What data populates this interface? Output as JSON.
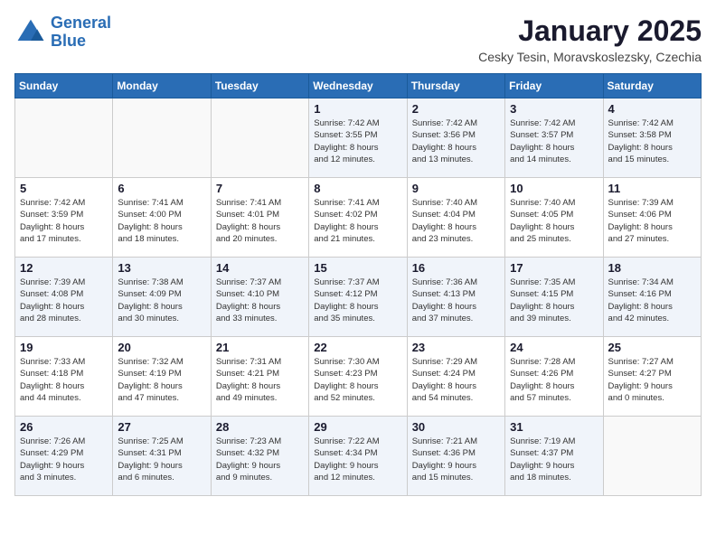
{
  "logo": {
    "line1": "General",
    "line2": "Blue"
  },
  "title": "January 2025",
  "location": "Cesky Tesin, Moravskoslezsky, Czechia",
  "days_of_week": [
    "Sunday",
    "Monday",
    "Tuesday",
    "Wednesday",
    "Thursday",
    "Friday",
    "Saturday"
  ],
  "weeks": [
    [
      {
        "day": "",
        "info": ""
      },
      {
        "day": "",
        "info": ""
      },
      {
        "day": "",
        "info": ""
      },
      {
        "day": "1",
        "info": "Sunrise: 7:42 AM\nSunset: 3:55 PM\nDaylight: 8 hours\nand 12 minutes."
      },
      {
        "day": "2",
        "info": "Sunrise: 7:42 AM\nSunset: 3:56 PM\nDaylight: 8 hours\nand 13 minutes."
      },
      {
        "day": "3",
        "info": "Sunrise: 7:42 AM\nSunset: 3:57 PM\nDaylight: 8 hours\nand 14 minutes."
      },
      {
        "day": "4",
        "info": "Sunrise: 7:42 AM\nSunset: 3:58 PM\nDaylight: 8 hours\nand 15 minutes."
      }
    ],
    [
      {
        "day": "5",
        "info": "Sunrise: 7:42 AM\nSunset: 3:59 PM\nDaylight: 8 hours\nand 17 minutes."
      },
      {
        "day": "6",
        "info": "Sunrise: 7:41 AM\nSunset: 4:00 PM\nDaylight: 8 hours\nand 18 minutes."
      },
      {
        "day": "7",
        "info": "Sunrise: 7:41 AM\nSunset: 4:01 PM\nDaylight: 8 hours\nand 20 minutes."
      },
      {
        "day": "8",
        "info": "Sunrise: 7:41 AM\nSunset: 4:02 PM\nDaylight: 8 hours\nand 21 minutes."
      },
      {
        "day": "9",
        "info": "Sunrise: 7:40 AM\nSunset: 4:04 PM\nDaylight: 8 hours\nand 23 minutes."
      },
      {
        "day": "10",
        "info": "Sunrise: 7:40 AM\nSunset: 4:05 PM\nDaylight: 8 hours\nand 25 minutes."
      },
      {
        "day": "11",
        "info": "Sunrise: 7:39 AM\nSunset: 4:06 PM\nDaylight: 8 hours\nand 27 minutes."
      }
    ],
    [
      {
        "day": "12",
        "info": "Sunrise: 7:39 AM\nSunset: 4:08 PM\nDaylight: 8 hours\nand 28 minutes."
      },
      {
        "day": "13",
        "info": "Sunrise: 7:38 AM\nSunset: 4:09 PM\nDaylight: 8 hours\nand 30 minutes."
      },
      {
        "day": "14",
        "info": "Sunrise: 7:37 AM\nSunset: 4:10 PM\nDaylight: 8 hours\nand 33 minutes."
      },
      {
        "day": "15",
        "info": "Sunrise: 7:37 AM\nSunset: 4:12 PM\nDaylight: 8 hours\nand 35 minutes."
      },
      {
        "day": "16",
        "info": "Sunrise: 7:36 AM\nSunset: 4:13 PM\nDaylight: 8 hours\nand 37 minutes."
      },
      {
        "day": "17",
        "info": "Sunrise: 7:35 AM\nSunset: 4:15 PM\nDaylight: 8 hours\nand 39 minutes."
      },
      {
        "day": "18",
        "info": "Sunrise: 7:34 AM\nSunset: 4:16 PM\nDaylight: 8 hours\nand 42 minutes."
      }
    ],
    [
      {
        "day": "19",
        "info": "Sunrise: 7:33 AM\nSunset: 4:18 PM\nDaylight: 8 hours\nand 44 minutes."
      },
      {
        "day": "20",
        "info": "Sunrise: 7:32 AM\nSunset: 4:19 PM\nDaylight: 8 hours\nand 47 minutes."
      },
      {
        "day": "21",
        "info": "Sunrise: 7:31 AM\nSunset: 4:21 PM\nDaylight: 8 hours\nand 49 minutes."
      },
      {
        "day": "22",
        "info": "Sunrise: 7:30 AM\nSunset: 4:23 PM\nDaylight: 8 hours\nand 52 minutes."
      },
      {
        "day": "23",
        "info": "Sunrise: 7:29 AM\nSunset: 4:24 PM\nDaylight: 8 hours\nand 54 minutes."
      },
      {
        "day": "24",
        "info": "Sunrise: 7:28 AM\nSunset: 4:26 PM\nDaylight: 8 hours\nand 57 minutes."
      },
      {
        "day": "25",
        "info": "Sunrise: 7:27 AM\nSunset: 4:27 PM\nDaylight: 9 hours\nand 0 minutes."
      }
    ],
    [
      {
        "day": "26",
        "info": "Sunrise: 7:26 AM\nSunset: 4:29 PM\nDaylight: 9 hours\nand 3 minutes."
      },
      {
        "day": "27",
        "info": "Sunrise: 7:25 AM\nSunset: 4:31 PM\nDaylight: 9 hours\nand 6 minutes."
      },
      {
        "day": "28",
        "info": "Sunrise: 7:23 AM\nSunset: 4:32 PM\nDaylight: 9 hours\nand 9 minutes."
      },
      {
        "day": "29",
        "info": "Sunrise: 7:22 AM\nSunset: 4:34 PM\nDaylight: 9 hours\nand 12 minutes."
      },
      {
        "day": "30",
        "info": "Sunrise: 7:21 AM\nSunset: 4:36 PM\nDaylight: 9 hours\nand 15 minutes."
      },
      {
        "day": "31",
        "info": "Sunrise: 7:19 AM\nSunset: 4:37 PM\nDaylight: 9 hours\nand 18 minutes."
      },
      {
        "day": "",
        "info": ""
      }
    ]
  ]
}
